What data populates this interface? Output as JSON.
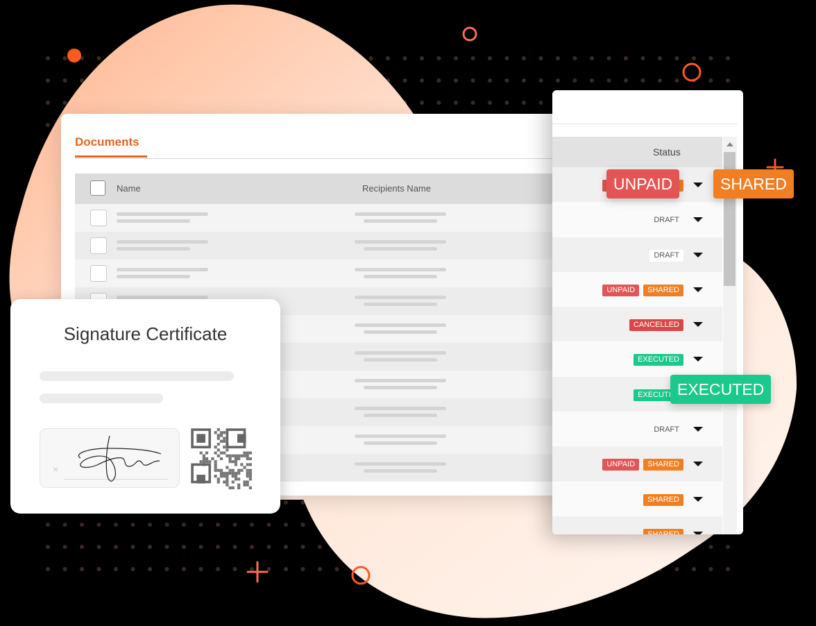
{
  "documents": {
    "title": "Documents",
    "columns": {
      "name": "Name",
      "recipients": "Recipients Name"
    },
    "row_count": 10
  },
  "status_panel": {
    "header": "Status",
    "rows": [
      {
        "badges": [
          {
            "label": "UNPAID",
            "kind": "unpaid"
          },
          {
            "label": "SHARED",
            "kind": "shared"
          }
        ]
      },
      {
        "badges": [
          {
            "label": "DRAFT",
            "kind": "draft"
          }
        ]
      },
      {
        "badges": [
          {
            "label": "DRAFT",
            "kind": "draft boxed"
          }
        ]
      },
      {
        "badges": [
          {
            "label": "UNPAID",
            "kind": "unpaid"
          },
          {
            "label": "SHARED",
            "kind": "shared"
          }
        ]
      },
      {
        "badges": [
          {
            "label": "CANCELLED",
            "kind": "cancelled"
          }
        ]
      },
      {
        "badges": [
          {
            "label": "EXECUTED",
            "kind": "executed"
          }
        ]
      },
      {
        "badges": [
          {
            "label": "EXECUTED",
            "kind": "executed"
          }
        ]
      },
      {
        "badges": [
          {
            "label": "DRAFT",
            "kind": "draft"
          }
        ]
      },
      {
        "badges": [
          {
            "label": "UNPAID",
            "kind": "unpaid"
          },
          {
            "label": "SHARED",
            "kind": "shared"
          }
        ]
      },
      {
        "badges": [
          {
            "label": "SHARED",
            "kind": "shared"
          }
        ]
      },
      {
        "badges": [
          {
            "label": "SHARED",
            "kind": "shared"
          }
        ]
      }
    ]
  },
  "callouts": {
    "unpaid": "UNPAID",
    "shared": "SHARED",
    "executed": "EXECUTED"
  },
  "certificate": {
    "title": "Signature Certificate",
    "clear_mark": "×"
  },
  "colors": {
    "accent": "#e8641b",
    "unpaid": "#e35555",
    "shared": "#f07f24",
    "executed": "#1cc98d",
    "blob": "#ffd8c2"
  }
}
